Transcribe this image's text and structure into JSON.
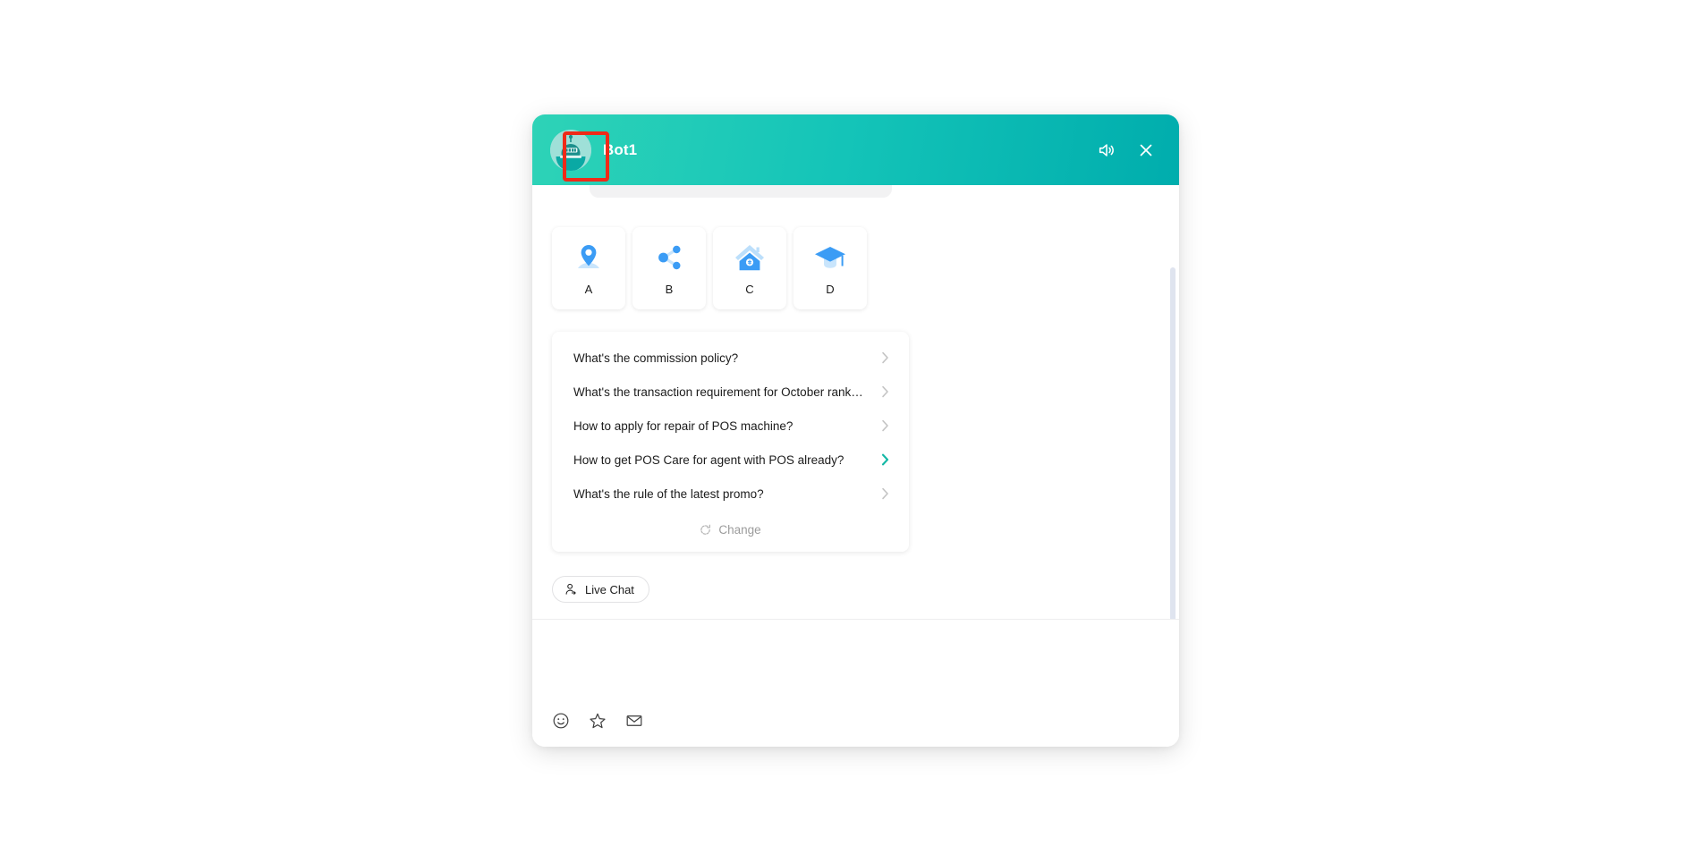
{
  "widget": {
    "header": {
      "avatar_icon": "robot-avatar-icon",
      "title": "Bot1",
      "sound_icon": "speaker-icon",
      "close_icon": "close-icon"
    },
    "categories": [
      {
        "label": "A",
        "icon": "location-pin-icon"
      },
      {
        "label": "B",
        "icon": "share-nodes-icon"
      },
      {
        "label": "C",
        "icon": "house-money-icon"
      },
      {
        "label": "D",
        "icon": "graduation-cap-icon"
      }
    ],
    "faq": {
      "items": [
        {
          "text": "What's the commission policy?",
          "active": false
        },
        {
          "text": "What's the transaction requirement for October rank…",
          "active": false
        },
        {
          "text": "How to apply for repair of POS machine?",
          "active": false
        },
        {
          "text": "How to get POS Care for agent with POS already?",
          "active": true
        },
        {
          "text": "What's the rule of the latest promo?",
          "active": false
        }
      ],
      "change_label": "Change",
      "change_icon": "refresh-icon"
    },
    "live_chat": {
      "label": "Live Chat",
      "icon": "person-switch-icon"
    },
    "composer": {
      "placeholder": "",
      "value": "",
      "tools": [
        {
          "icon": "smiley-icon"
        },
        {
          "icon": "star-icon"
        },
        {
          "icon": "envelope-icon"
        }
      ]
    }
  },
  "colors": {
    "header_gradient_start": "#2ed3b7",
    "header_gradient_end": "#00adad",
    "accent_teal": "#14b8a6",
    "icon_blue": "#3b9cf5",
    "icon_blue_light": "#bcdffb",
    "annotation_red": "#ef2a18",
    "scrollbar_thumb": "#dfe4ef",
    "page_background": "#ffffff"
  }
}
